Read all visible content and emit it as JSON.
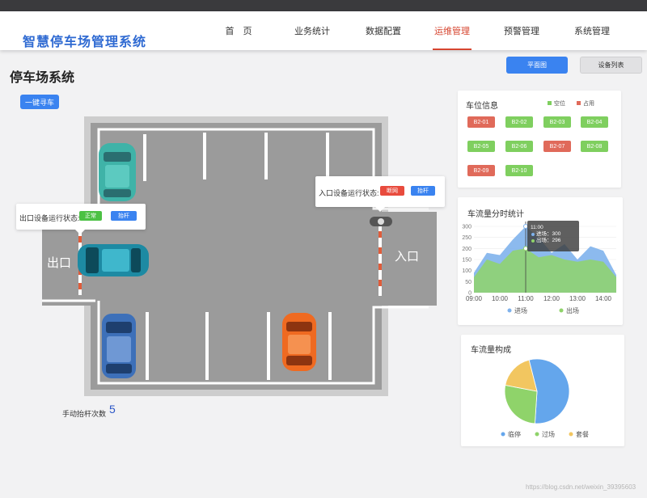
{
  "app": {
    "title": "智慧停车场管理系统"
  },
  "nav": [
    {
      "label": "首　页",
      "active": false
    },
    {
      "label": "业务统计",
      "active": false
    },
    {
      "label": "数据配置",
      "active": false
    },
    {
      "label": "运维管理",
      "active": true
    },
    {
      "label": "预警管理",
      "active": false
    },
    {
      "label": "系统管理",
      "active": false
    }
  ],
  "page": {
    "title": "停车场系统",
    "view_floorplan": "平面图",
    "view_devices": "设备列表",
    "find_car": "一键寻车"
  },
  "lot": {
    "exit_label": "出口",
    "entry_label": "入口",
    "exit_status": {
      "label": "出口设备运行状态:",
      "state": "正常",
      "action": "抬杆"
    },
    "entry_status": {
      "label": "入口设备运行状态:",
      "state": "断网",
      "action": "抬杆"
    },
    "manual_lift_label": "手动抬杆次数",
    "manual_lift_count": "5"
  },
  "parking": {
    "title": "车位信息",
    "legend_free": "空位",
    "legend_used": "占用",
    "slots": [
      {
        "id": "B2-01",
        "status": "used"
      },
      {
        "id": "B2-02",
        "status": "free"
      },
      {
        "id": "B2-03",
        "status": "free"
      },
      {
        "id": "B2-04",
        "status": "free"
      },
      {
        "id": "B2-05",
        "status": "free"
      },
      {
        "id": "B2-06",
        "status": "free"
      },
      {
        "id": "B2-07",
        "status": "used"
      },
      {
        "id": "B2-08",
        "status": "free"
      },
      {
        "id": "B2-09",
        "status": "used"
      },
      {
        "id": "B2-10",
        "status": "free"
      }
    ]
  },
  "colors": {
    "free": "#7fcf5f",
    "used": "#e06a5a",
    "accent": "#3a83f0",
    "nav_active": "#d6452f",
    "entry_series": "#7fb2ec",
    "exit_series": "#8fd36a"
  },
  "chart_data": [
    {
      "type": "area",
      "title": "车流量分时统计",
      "x": [
        "09:00",
        "09:30",
        "10:00",
        "10:30",
        "11:00",
        "11:30",
        "12:00",
        "12:30",
        "13:00",
        "13:30",
        "14:00",
        "14:30"
      ],
      "ylim": [
        0,
        300
      ],
      "yticks": [
        0,
        50,
        100,
        150,
        200,
        250,
        300
      ],
      "xticks": [
        "09:00",
        "10:00",
        "11:00",
        "12:00",
        "13:00",
        "14:00"
      ],
      "series": [
        {
          "name": "进场",
          "values": [
            90,
            180,
            170,
            240,
            300,
            250,
            180,
            220,
            150,
            210,
            190,
            80
          ]
        },
        {
          "name": "出场",
          "values": [
            70,
            150,
            130,
            190,
            200,
            160,
            170,
            150,
            140,
            150,
            140,
            70
          ]
        }
      ],
      "tooltip": {
        "time": "11:00",
        "entry_label": "进场",
        "entry_value": "300",
        "exit_label": "出场",
        "exit_value": "296"
      }
    },
    {
      "type": "pie",
      "title": "车流量构成",
      "slices": [
        {
          "name": "临停",
          "value": 55,
          "color": "#64a6ec"
        },
        {
          "name": "过场",
          "value": 27,
          "color": "#8fd36a"
        },
        {
          "name": "套餐",
          "value": 18,
          "color": "#f2c660"
        }
      ]
    }
  ],
  "watermark": "https://blog.csdn.net/weixin_39395603"
}
